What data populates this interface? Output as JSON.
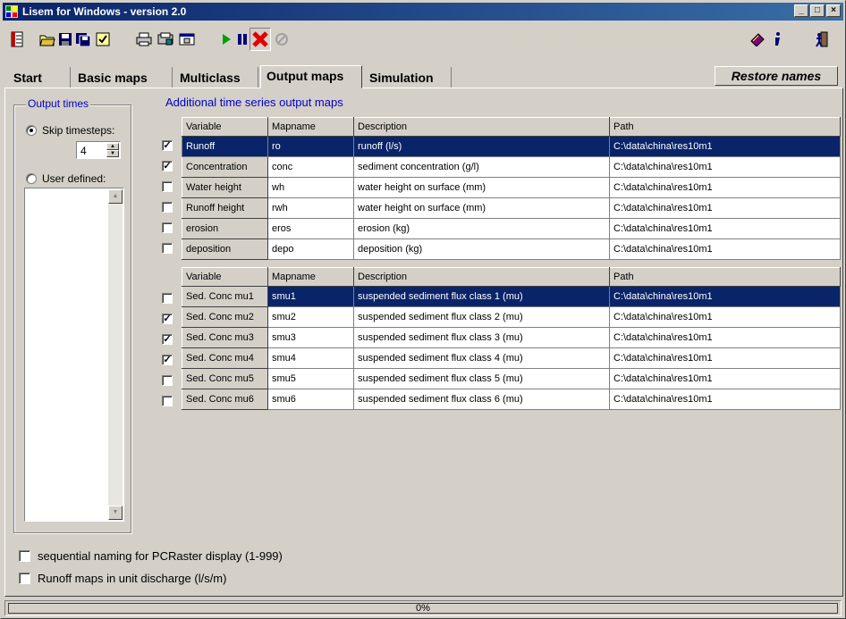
{
  "window": {
    "title": "Lisem for Windows - version 2.0"
  },
  "tabs": [
    {
      "label": "Start"
    },
    {
      "label": "Basic maps"
    },
    {
      "label": "Multiclass"
    },
    {
      "label": "Output maps",
      "active": true
    },
    {
      "label": "Simulation"
    }
  ],
  "restore_label": "Restore names",
  "output_times": {
    "title": "Output times",
    "skip_label": "Skip timesteps:",
    "skip_value": "4",
    "user_label": "User defined:"
  },
  "section_title": "Additional time series output maps",
  "columns": {
    "variable": "Variable",
    "mapname": "Mapname",
    "description": "Description",
    "path": "Path"
  },
  "grid1": [
    {
      "checked": true,
      "variable": "Runoff",
      "mapname": "ro",
      "description": "runoff (l/s)",
      "path": "C:\\data\\china\\res10m1",
      "selected": true
    },
    {
      "checked": true,
      "variable": "Concentration",
      "mapname": "conc",
      "description": "sediment concentration (g/l)",
      "path": "C:\\data\\china\\res10m1"
    },
    {
      "checked": false,
      "variable": "Water height",
      "mapname": "wh",
      "description": "water height on surface (mm)",
      "path": "C:\\data\\china\\res10m1"
    },
    {
      "checked": false,
      "variable": "Runoff height",
      "mapname": "rwh",
      "description": "water height on surface (mm)",
      "path": "C:\\data\\china\\res10m1"
    },
    {
      "checked": false,
      "variable": "erosion",
      "mapname": "eros",
      "description": "erosion (kg)",
      "path": "C:\\data\\china\\res10m1"
    },
    {
      "checked": false,
      "variable": "deposition",
      "mapname": "depo",
      "description": "deposition (kg)",
      "path": "C:\\data\\china\\res10m1"
    }
  ],
  "grid2": [
    {
      "checked": false,
      "variable": "Sed. Conc mu1",
      "mapname": "smu1",
      "description": "suspended sediment flux class 1 (mu)",
      "path": "C:\\data\\china\\res10m1",
      "selected": true
    },
    {
      "checked": true,
      "variable": "Sed. Conc mu2",
      "mapname": "smu2",
      "description": "suspended sediment flux class 2 (mu)",
      "path": "C:\\data\\china\\res10m1"
    },
    {
      "checked": true,
      "variable": "Sed. Conc mu3",
      "mapname": "smu3",
      "description": "suspended sediment flux class 3 (mu)",
      "path": "C:\\data\\china\\res10m1"
    },
    {
      "checked": true,
      "variable": "Sed. Conc mu4",
      "mapname": "smu4",
      "description": "suspended sediment flux class 4 (mu)",
      "path": "C:\\data\\china\\res10m1"
    },
    {
      "checked": false,
      "variable": "Sed. Conc mu5",
      "mapname": "smu5",
      "description": "suspended sediment flux class 5 (mu)",
      "path": "C:\\data\\china\\res10m1"
    },
    {
      "checked": false,
      "variable": "Sed. Conc mu6",
      "mapname": "smu6",
      "description": "suspended sediment flux class 6 (mu)",
      "path": "C:\\data\\china\\res10m1"
    }
  ],
  "options": {
    "sequential_label": "sequential naming for PCRaster display (1-999)",
    "runoff_unit_label": "Runoff maps in unit discharge (l/s/m)"
  },
  "status": {
    "progress_text": "0%",
    "progress": 0
  },
  "toolbar_icons": [
    "settings-icon",
    "open-folder-icon",
    "save-icon",
    "save-as-icon",
    "check-icon",
    "print-icon",
    "print-preview-icon",
    "window-icon",
    "run-icon",
    "pause-icon",
    "stop-icon",
    "reset-icon",
    "help-book-icon",
    "info-icon",
    "exit-icon"
  ]
}
